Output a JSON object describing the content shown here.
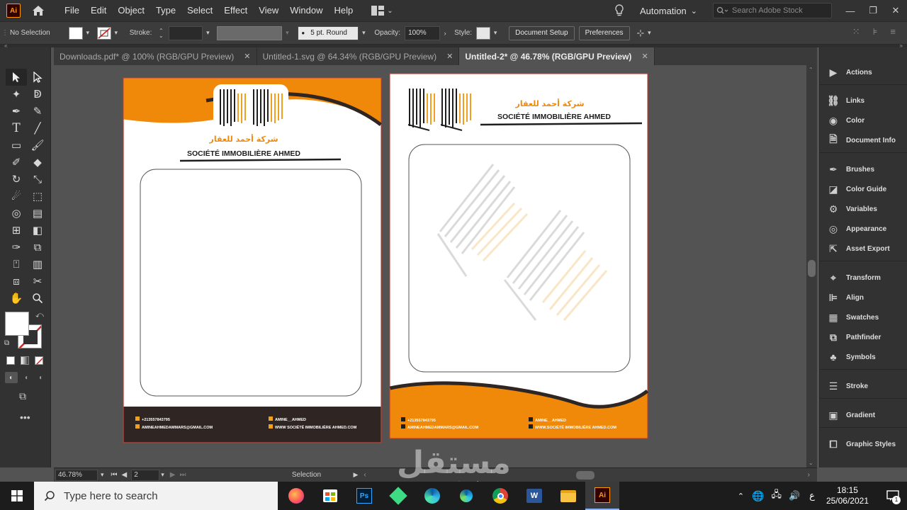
{
  "app": {
    "logo_text": "Ai"
  },
  "menu": [
    "File",
    "Edit",
    "Object",
    "Type",
    "Select",
    "Effect",
    "View",
    "Window",
    "Help"
  ],
  "workspace": {
    "label": "Automation"
  },
  "stock_search": {
    "placeholder": "Search Adobe Stock"
  },
  "control": {
    "selection": "No Selection",
    "stroke_label": "Stroke:",
    "brush": "5 pt. Round",
    "opacity_label": "Opacity:",
    "opacity_value": "100%",
    "style_label": "Style:",
    "document_setup": "Document Setup",
    "preferences": "Preferences"
  },
  "tabs": [
    {
      "label": "Downloads.pdf* @ 100% (RGB/GPU Preview)"
    },
    {
      "label": "Untitled-1.svg @ 64.34% (RGB/GPU Preview)"
    },
    {
      "label": "Untitled-2* @ 46.78% (RGB/GPU Preview)"
    }
  ],
  "panels": [
    "Actions",
    "Links",
    "Color",
    "Document Info",
    "Brushes",
    "Color Guide",
    "Variables",
    "Appearance",
    "Asset Export",
    "Transform",
    "Align",
    "Swatches",
    "Pathfinder",
    "Symbols",
    "Stroke",
    "Gradient",
    "Graphic Styles"
  ],
  "letterhead": {
    "arabic_name": "شركة أحمد للعقار",
    "company_name": "SOCIÉTÉ IMMOBILIÈRE AHMED",
    "phone": "+213557843795",
    "email": "AMINEAHMEDAMMARS@GMAIL.COM",
    "social": "AMINE__AHMED",
    "website": "WWW SOCIÉTÉ IMMOBILIÈRE AHMED.COM",
    "website2": "WWW.SOCIÉTÉ IMMOBILIÈRE AHMED.COM"
  },
  "status": {
    "zoom": "46.78%",
    "artboard": "2",
    "mode": "Selection"
  },
  "taskbar": {
    "search_placeholder": "Type here to search",
    "time": "18:15",
    "date": "25/06/2021",
    "lang": "ع",
    "notifications": "1"
  },
  "watermark": {
    "text": "مستقل",
    "domain": "mostaql.com"
  },
  "colors": {
    "brand_orange": "#f0880a",
    "dark_brown": "#2f2624",
    "ui_dark": "#323232",
    "canvas": "#535353"
  }
}
